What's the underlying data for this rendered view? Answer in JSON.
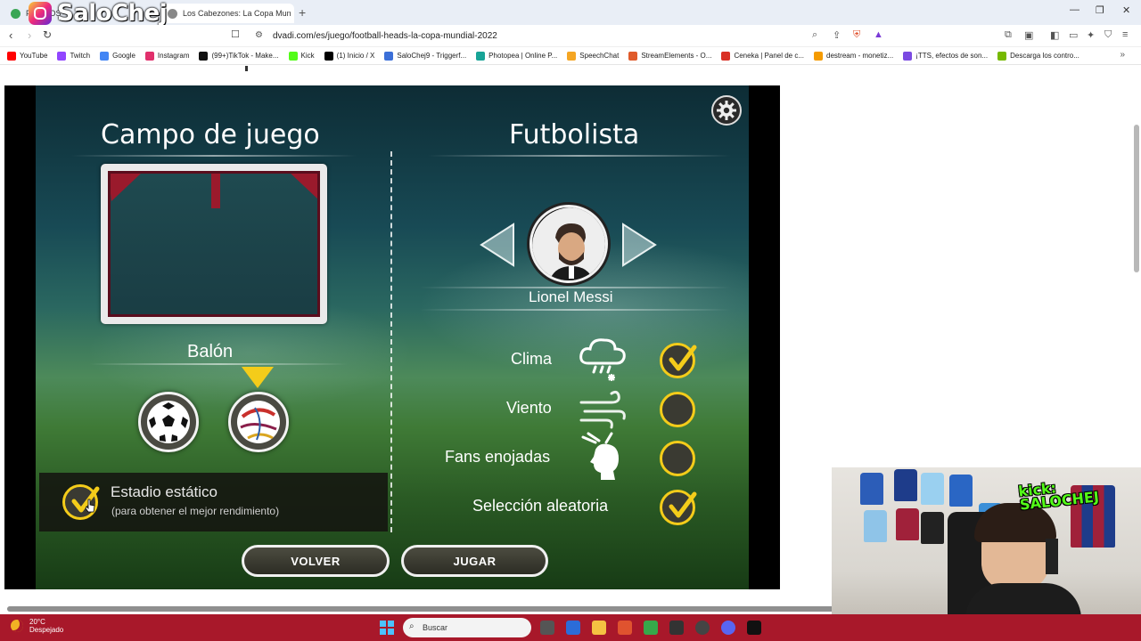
{
  "browser": {
    "tabs": [
      {
        "label": "PR...DOS",
        "active": false
      },
      {
        "label": "Los Cabezones: La Copa Mun",
        "active": true
      }
    ],
    "url": "dvadi.com/es/juego/football-heads-la-copa-mundial-2022",
    "new_tab": "+",
    "bookmarks": [
      {
        "label": "YouTube",
        "color": "#ff0000"
      },
      {
        "label": "Twitch",
        "color": "#9146ff"
      },
      {
        "label": "Google",
        "color": "#4285f4"
      },
      {
        "label": "Instagram",
        "color": "#e1306c"
      },
      {
        "label": "(99+)TikTok - Make...",
        "color": "#111111"
      },
      {
        "label": "Kick",
        "color": "#53fc18"
      },
      {
        "label": "(1) Inicio / X",
        "color": "#000000"
      },
      {
        "label": "SaloChej9 - Triggerf...",
        "color": "#3b6fd8"
      },
      {
        "label": "Photopea | Online P...",
        "color": "#18a497"
      },
      {
        "label": "SpeechChat",
        "color": "#f5a623"
      },
      {
        "label": "StreamElements - O...",
        "color": "#e05a2a"
      },
      {
        "label": "Ceneka | Panel de c...",
        "color": "#d93025"
      },
      {
        "label": "destream - monetiz...",
        "color": "#f59b00"
      },
      {
        "label": "¡TTS, efectos de son...",
        "color": "#7b4ae2"
      },
      {
        "label": "Descarga los contro...",
        "color": "#76b900"
      }
    ]
  },
  "overlay": {
    "brand": "SaloChej",
    "kick_label": "kick:",
    "kick_name": "SALOCHEJ"
  },
  "game": {
    "field_title": "Campo de juego",
    "player_title": "Futbolista",
    "ball_label": "Balón",
    "player_name": "Lionel Messi",
    "static_stadium": {
      "label": "Estadio estático",
      "sublabel": "(para obtener el mejor rendimiento)",
      "checked": true
    },
    "options": [
      {
        "label": "Clima",
        "icon": "weather-icon",
        "checked": true
      },
      {
        "label": "Viento",
        "icon": "wind-icon",
        "checked": false
      },
      {
        "label": "Fans enojadas",
        "icon": "angry-fan-icon",
        "checked": false
      },
      {
        "label": "Selección aleatoria",
        "icon": "",
        "checked": true
      }
    ],
    "buttons": {
      "back": "VOLVER",
      "play": "JUGAR"
    },
    "selected_ball": 2,
    "accent": "#f4cc1a"
  },
  "taskbar": {
    "temperature": "20°C",
    "condition": "Despejado",
    "search_placeholder": "Buscar"
  }
}
